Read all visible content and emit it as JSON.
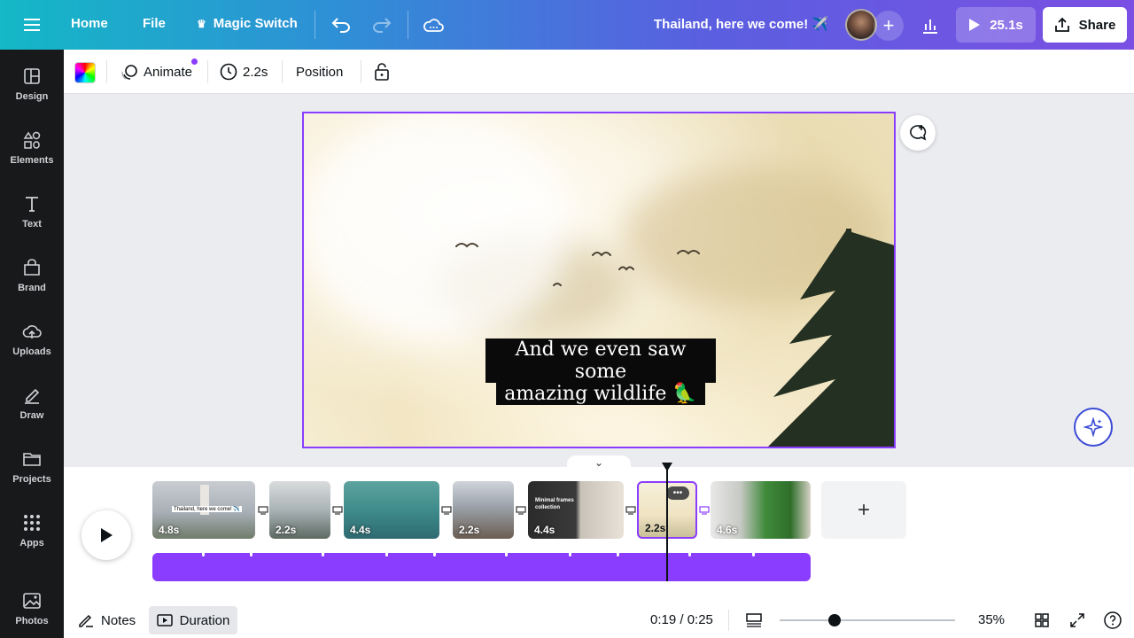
{
  "topbar": {
    "home": "Home",
    "file": "File",
    "magic_switch": "Magic Switch",
    "doc_title": "Thailand, here we come! ✈️",
    "play_duration": "25.1s",
    "share": "Share"
  },
  "sidebar": {
    "items": [
      {
        "label": "Design"
      },
      {
        "label": "Elements"
      },
      {
        "label": "Text"
      },
      {
        "label": "Brand"
      },
      {
        "label": "Uploads"
      },
      {
        "label": "Draw"
      },
      {
        "label": "Projects"
      },
      {
        "label": "Apps"
      },
      {
        "label": "Photos"
      }
    ]
  },
  "toolbar": {
    "animate": "Animate",
    "duration": "2.2s",
    "position": "Position"
  },
  "canvas": {
    "caption_line1": "And we even saw some",
    "caption_line2": "amazing wildlife 🦜"
  },
  "timeline": {
    "clips": [
      {
        "duration": "4.8s",
        "caption": "Thailand, here we come! ✈️"
      },
      {
        "duration": "2.2s",
        "caption": ""
      },
      {
        "duration": "4.4s",
        "caption": ""
      },
      {
        "duration": "2.2s",
        "caption": ""
      },
      {
        "duration": "4.4s",
        "caption": "Minimal frames collection"
      },
      {
        "duration": "2.2s",
        "caption": ""
      },
      {
        "duration": "4.6s",
        "caption": ""
      }
    ],
    "more_badge": "•••",
    "add": "+"
  },
  "bottombar": {
    "notes": "Notes",
    "duration": "Duration",
    "timecode": "0:19 / 0:25",
    "zoom": "35%"
  },
  "colors": {
    "accent": "#8b3dff",
    "sidebar_bg": "#18191b",
    "topbar_gradient_start": "#14b8c6",
    "topbar_gradient_end": "#7b4fe3"
  }
}
